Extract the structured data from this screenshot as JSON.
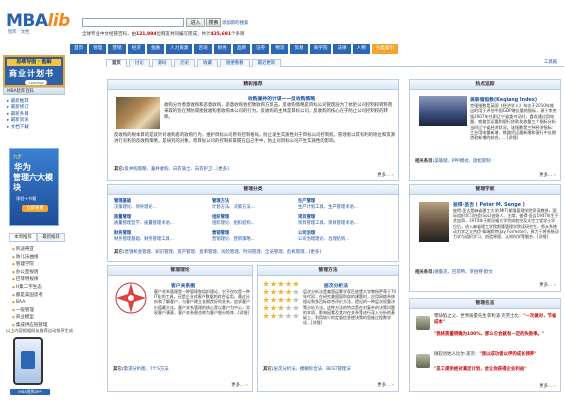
{
  "header": {
    "logo_main": "MBA",
    "logo_lib": "lib",
    "logo_sub": "智库 · 文档",
    "search_value": "",
    "btn_enter": "进入",
    "btn_search": "搜索",
    "search_link": "添加新的搜索",
    "stat_prefix": "全球专业中文经管百科，由",
    "stat_users": "121,994",
    "stat_mid": "位网友共同编写而成，共计",
    "stat_pages": "435,691",
    "stat_suffix": "个条目"
  },
  "nav": [
    {
      "label": "首页",
      "hl": false
    },
    {
      "label": "管理",
      "hl": false
    },
    {
      "label": "营销",
      "hl": false
    },
    {
      "label": "经济",
      "hl": false
    },
    {
      "label": "金融",
      "hl": false
    },
    {
      "label": "人力资源",
      "hl": false
    },
    {
      "label": "咨询",
      "hl": false
    },
    {
      "label": "财务",
      "hl": false
    },
    {
      "label": "品牌",
      "hl": false
    },
    {
      "label": "证券",
      "hl": false
    },
    {
      "label": "物流",
      "hl": false
    },
    {
      "label": "贸易",
      "hl": false
    },
    {
      "label": "商学院",
      "hl": false
    },
    {
      "label": "法律",
      "hl": false
    },
    {
      "label": "人物",
      "hl": false
    },
    {
      "label": "分类索引",
      "hl": true
    }
  ],
  "tabs": [
    "首页",
    "讨论",
    "源码",
    "历史",
    "收藏",
    "随便看看",
    "最近更新"
  ],
  "tabs_right": "工具箱",
  "sidebar": {
    "book_top": "思维导图 · 图解",
    "book_title": "商业计划书",
    "book_tag": "Loading",
    "bar_label": "MBA智库百科",
    "links": [
      "最新推荐",
      "最新修订",
      "最新条目",
      "最新资讯",
      "文档下载"
    ],
    "ad_top": "九步",
    "ad_line1": "华为",
    "ad_line2": "管理六大模块",
    "ad_desc": "课程+书籍",
    "ad_btn": "立即查看",
    "tab1": "本周推荐",
    "tab2": "最新推荐",
    "list2": [
      "阿迪蒂亚",
      "防儿乐曲线",
      "管理学院",
      "办公室规则",
      "巴菲特规律",
      "H集二字生态",
      "都是美国思考",
      "BAA",
      "一般管理",
      "商业模型",
      "集成供应链管理"
    ],
    "note": "以上内容根据网友推荐自动排序生成",
    "app_label": "MBA智库APP"
  },
  "featured": {
    "title": "精彩推荐",
    "headline": "收购兼并的计谋——反收购策略",
    "para1": "收购分为善意收购和恶意收购，恶意收购会招致收购方反击。反收购策略是目标公司管理层为了抗拒公司控制权转移而采取的旨在预防或挫败收购者收购本公司的行为。反收购的主体是目标公司，反收购的核心在于防止公司控制权的转移。",
    "para2": "反收购的根本目的是就针对收购者的收购行为，维护目标公司原有控制格局，防止发生实质性对于目标公司控制权。管理者以其有利的地位和资源进行有利的反收购策略，是研究的对象，而目标公司的控制权掌握在自己手中，防止对目标公司产生实质性的影响。",
    "tags_label": "其它:",
    "tags": "反并购策略、兼并收购、白衣骑士、白衣护卫...[更多]",
    "more": "更多..."
  },
  "hot": {
    "title": "热点追踪",
    "item_title": "美联储指数(Keqiang Index)",
    "item_text": "克强指数是英国《经济学人》杂志于2010年推出的用于评估中国GDP增长量的指标，源于李克强2007年任职辽宁省委书记时，喜欢通过用电量、铁路货运量和银行贷款发放量三个指标分析当时辽宁省经济状况。该指数是三种经济指标：工业用电量新增、铁路货运量新增和银行中长期贷款新增的结合。...[详细]",
    "related_label": "相关条目:",
    "related": "美联储、PPP模式、放松管制",
    "more": "更多..."
  },
  "cat": {
    "title": "管理分类",
    "cells": [
      {
        "h": "管理基础",
        "t": "决策理论、领导理论..."
      },
      {
        "h": "管理方法",
        "t": "计划方法、决策方法..."
      },
      {
        "h": "生产管理",
        "t": "生产计划工具、生产管理术语..."
      },
      {
        "h": "质量管理",
        "t": "质量管理哲学、质量管理术语..."
      },
      {
        "h": "组织管理",
        "t": "组织理论、组织结构..."
      },
      {
        "h": "项目管理",
        "t": "项目管理工具、项目管理术语..."
      },
      {
        "h": "财务管理",
        "t": "财务管理基础、财务管理工具..."
      },
      {
        "h": "营销管理",
        "t": "营销理论、营销策略..."
      },
      {
        "h": "公司治理",
        "t": "公司治理理论、治理结构..."
      }
    ],
    "tags_label": "其它:",
    "tags": "营销机会管理、知识管理、资产管理、变革管理、风险管理、时间管理、全员管理、危机管理...[更多]"
  },
  "scholar": {
    "title": "管理学家",
    "name": "彼得·圣吉 ( Peter M. Senge )",
    "text": "彼得·圣吉是麻省理工大学(MIT)斯隆管理学院资深教授，国际组织学习协会(SoL)创始人、主席。彼得·圣吉1947年生于芝加哥，1970年于斯坦福大学完成航空及太空工程学士学位后，进入麻省理工学院斯隆管理学院读研究生，师从系统动力学之父杰伊·弗瑞斯特(Jay Forrester)，致力于将系统动力学与组织学习、创造原理、认知科学等融合...[详细]",
    "related_label": "相关条目:",
    "related": "德鲁克、巴菲特、罗伯特·欧文",
    "more": "更多..."
  },
  "theory": {
    "title": "管理理论",
    "item_title": "客户关系图",
    "text": "客户关系管理是一种管理和组织理论，它不仅仅是一种IT化的工具，还是企业对客户数据的综合运用，通过分析和了解客户，与客户建立长期良好的关系，追求客户价值最大化。客户关系管理的核心是以客户为中心，实现客户满意，客户关系图也称为客户细分矩阵...[详细]",
    "tags_label": "其它:",
    "tags": "需求分析图、7个S方法",
    "more": "更多..."
  },
  "method": {
    "title": "管理方法",
    "item_title": "层次分析法",
    "text": "层次分析法是美国运筹学家匹兹堡大学教授萨蒂于70年代初，在研究美国国防部的课题时，应用网络系统理论和多目标综合评价方法，提出的一种层次权重决策分析方法。这种方法的特点是在对复杂的决策问题的本质、影响因素及其内在关系等进行深入分析的基础上，利用较少的定量信息使决策的思维过程数学化...[详细]",
    "tags_label": "其它:",
    "tags": "层次分析法、模糊综合法、BEST管理法",
    "more": "更多..."
  },
  "quotes": {
    "title": "管理名言",
    "items": [
      {
        "text": "零缺陷之父、世界质量先生菲利浦·克劳士比：",
        "bold": "\"一次做对，节省成本\""
      },
      {
        "text": "",
        "bold": "\"我将质量明确为100%，那么它会就有一定的失败率。\""
      },
      {
        "text": "微软创始人比尔·盖茨：",
        "bold": "\"我以成功者以伊的成长领养\""
      },
      {
        "text": "",
        "bold": "\"员工提供绝对满足计划，会让你获得企业利益\""
      }
    ],
    "more": "更多..."
  },
  "colors": {
    "accent": "#2b67b2",
    "highlight": "#f2a330",
    "link": "#1a4fa0"
  }
}
